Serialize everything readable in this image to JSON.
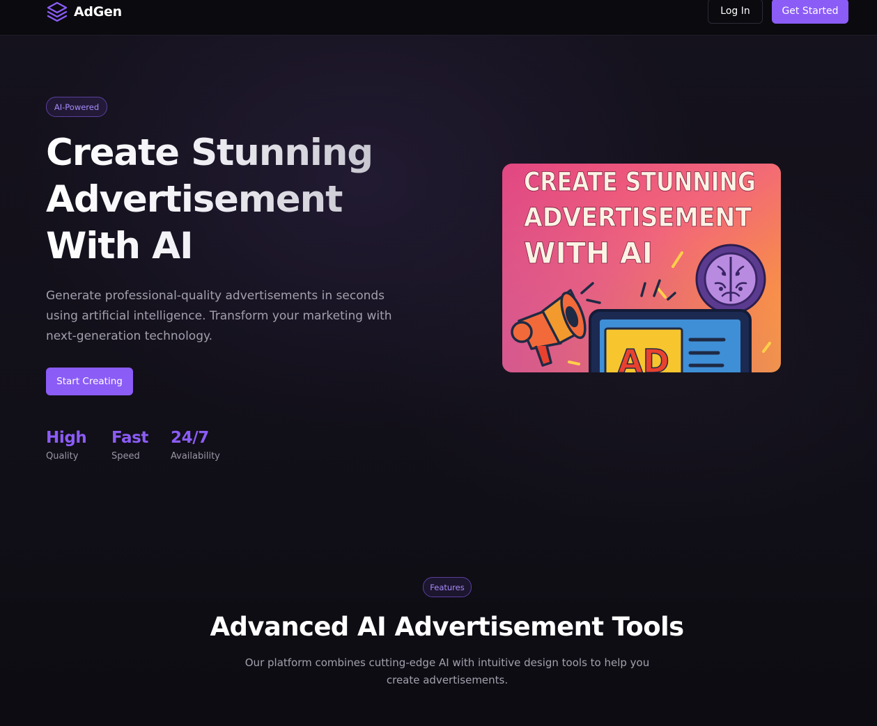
{
  "nav": {
    "brand": "AdGen",
    "login_label": "Log In",
    "get_started_label": "Get Started"
  },
  "hero": {
    "badge": "AI-Powered",
    "title_lines": [
      "Create Stunning",
      "Advertisement",
      "With AI"
    ],
    "description": "Generate professional-quality advertisements in seconds using artificial intelligence. Transform your marketing with next-generation technology.",
    "cta_label": "Start Creating",
    "stats": [
      {
        "value": "High",
        "label": "Quality"
      },
      {
        "value": "Fast",
        "label": "Speed"
      },
      {
        "value": "24/7",
        "label": "Availability"
      }
    ],
    "image": {
      "lines": [
        "CREATE STUNNING",
        "ADVERTISEMENT",
        "WITH AI"
      ],
      "screen_text": "AD"
    }
  },
  "features": {
    "badge": "Features",
    "title": "Advanced AI Advertisement Tools",
    "description": "Our platform combines cutting-edge AI with intuitive design tools to help you create advertisements."
  },
  "colors": {
    "accent": "#8b5cf6",
    "accent_light": "#a78bfa",
    "background": "#0f0d15",
    "nav_background": "#0b0a0f"
  }
}
